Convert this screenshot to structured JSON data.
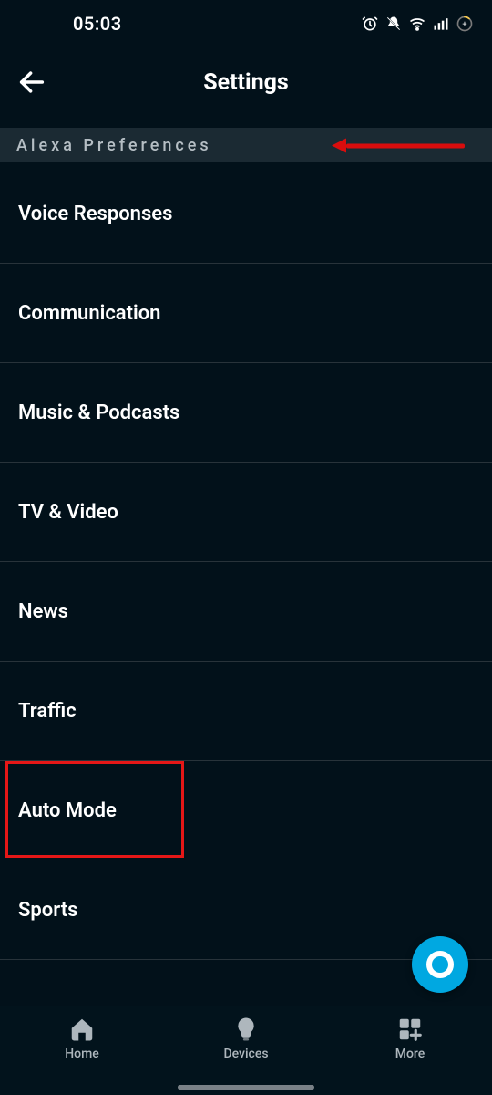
{
  "status": {
    "time": "05:03"
  },
  "header": {
    "title": "Settings"
  },
  "section": {
    "title": "Alexa Preferences"
  },
  "items": [
    {
      "label": "Voice Responses"
    },
    {
      "label": "Communication"
    },
    {
      "label": "Music & Podcasts"
    },
    {
      "label": "TV & Video"
    },
    {
      "label": "News"
    },
    {
      "label": "Traffic"
    },
    {
      "label": "Auto Mode"
    },
    {
      "label": "Sports"
    }
  ],
  "nav": {
    "home": "Home",
    "devices": "Devices",
    "more": "More"
  },
  "annotations": {
    "highlighted_item_index": 6
  }
}
